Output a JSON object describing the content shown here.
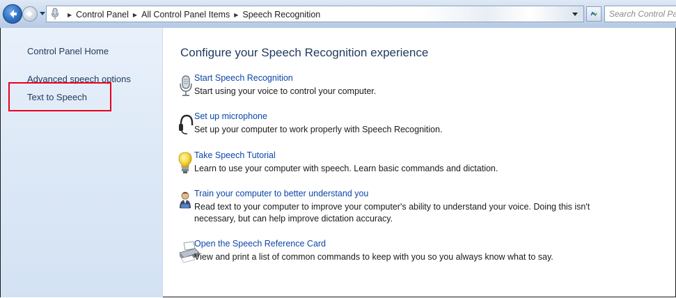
{
  "address_bar": {
    "breadcrumbs": [
      "Control Panel",
      "All Control Panel Items",
      "Speech Recognition"
    ],
    "search_placeholder": "Search Control Panel"
  },
  "left_pane": {
    "home": "Control Panel Home",
    "links": [
      "Advanced speech options",
      "Text to Speech"
    ]
  },
  "main": {
    "heading": "Configure your Speech Recognition experience",
    "tasks": [
      {
        "icon": "microphone-icon",
        "link": "Start Speech Recognition",
        "desc": "Start using your voice to control your computer."
      },
      {
        "icon": "headset-icon",
        "link": "Set up microphone",
        "desc": "Set up your computer to work properly with Speech Recognition."
      },
      {
        "icon": "lightbulb-icon",
        "link": "Take Speech Tutorial",
        "desc": "Learn to use your computer with speech.  Learn basic commands and dictation."
      },
      {
        "icon": "user-training-icon",
        "link": "Train your computer to better understand you",
        "desc": "Read text to your computer to improve your computer's ability to understand your voice.  Doing this isn't necessary, but can help improve dictation accuracy."
      },
      {
        "icon": "printer-icon",
        "link": "Open the Speech Reference Card",
        "desc": "View and print a list of common commands to keep with you so you always know what to say."
      }
    ]
  },
  "colors": {
    "link": "#0b46a8",
    "heading": "#1e395b",
    "highlight": "#e8001c"
  }
}
